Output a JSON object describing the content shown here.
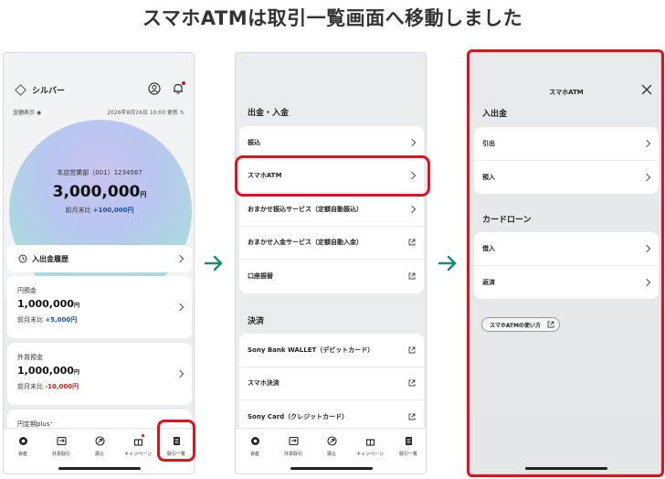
{
  "headline": "スマホATMは取引一覧画面へ移動しました",
  "colors": {
    "highlight": "#e0121c",
    "arrow": "#1e8a74",
    "blue_text": "#1a4e9c",
    "red_text": "#c8201a"
  },
  "screen1": {
    "rank": "シルバー",
    "amount_toggle": "金額表示",
    "updated": "2026年8月26日 10:00 更新",
    "branch": "本店営業部（001）1234567",
    "total": "3,000,000",
    "currency": "円",
    "delta_label": "前月末比",
    "delta_value": "+100,000円",
    "history_label": "入出金履歴",
    "accounts": [
      {
        "title": "円預金",
        "value": "1,000,000",
        "currency": "円",
        "delta_label": "前月末比",
        "delta": "+5,000円"
      },
      {
        "title": "外貨預金",
        "value": "1,000,000",
        "currency": "円",
        "delta_label": "前月末比",
        "delta": "-10,000円"
      },
      {
        "title": "円定期plus⁺"
      }
    ]
  },
  "tabs": [
    {
      "label": "資産",
      "icon": "asset-icon"
    },
    {
      "label": "外貨取引",
      "icon": "fx-icon"
    },
    {
      "label": "振込",
      "icon": "transfer-icon"
    },
    {
      "label": "キャンペーン",
      "icon": "gift-icon"
    },
    {
      "label": "取引一覧",
      "icon": "list-icon"
    }
  ],
  "screen2": {
    "section1": "出金・入金",
    "items1": [
      {
        "label": "振込",
        "icon": "chevron"
      },
      {
        "label": "スマホATM",
        "icon": "chevron"
      },
      {
        "label": "おまかせ振込サービス（定額自動振込）",
        "icon": "chevron"
      },
      {
        "label": "おまかせ入金サービス（定額自動入金）",
        "icon": "external"
      },
      {
        "label": "口座振替",
        "icon": "external"
      }
    ],
    "section2": "決済",
    "items2": [
      {
        "label": "Sony Bank WALLET（デビットカード）",
        "icon": "external"
      },
      {
        "label": "スマホ決済",
        "icon": "external"
      },
      {
        "label": "Sony Card（クレジットカード）",
        "icon": "external"
      }
    ]
  },
  "screen3": {
    "title": "スマホATM",
    "section1": "入出金",
    "items1": [
      "引出",
      "預入"
    ],
    "section2": "カードローン",
    "items2": [
      "借入",
      "返済"
    ],
    "howto": "スマホATMの使い方"
  }
}
